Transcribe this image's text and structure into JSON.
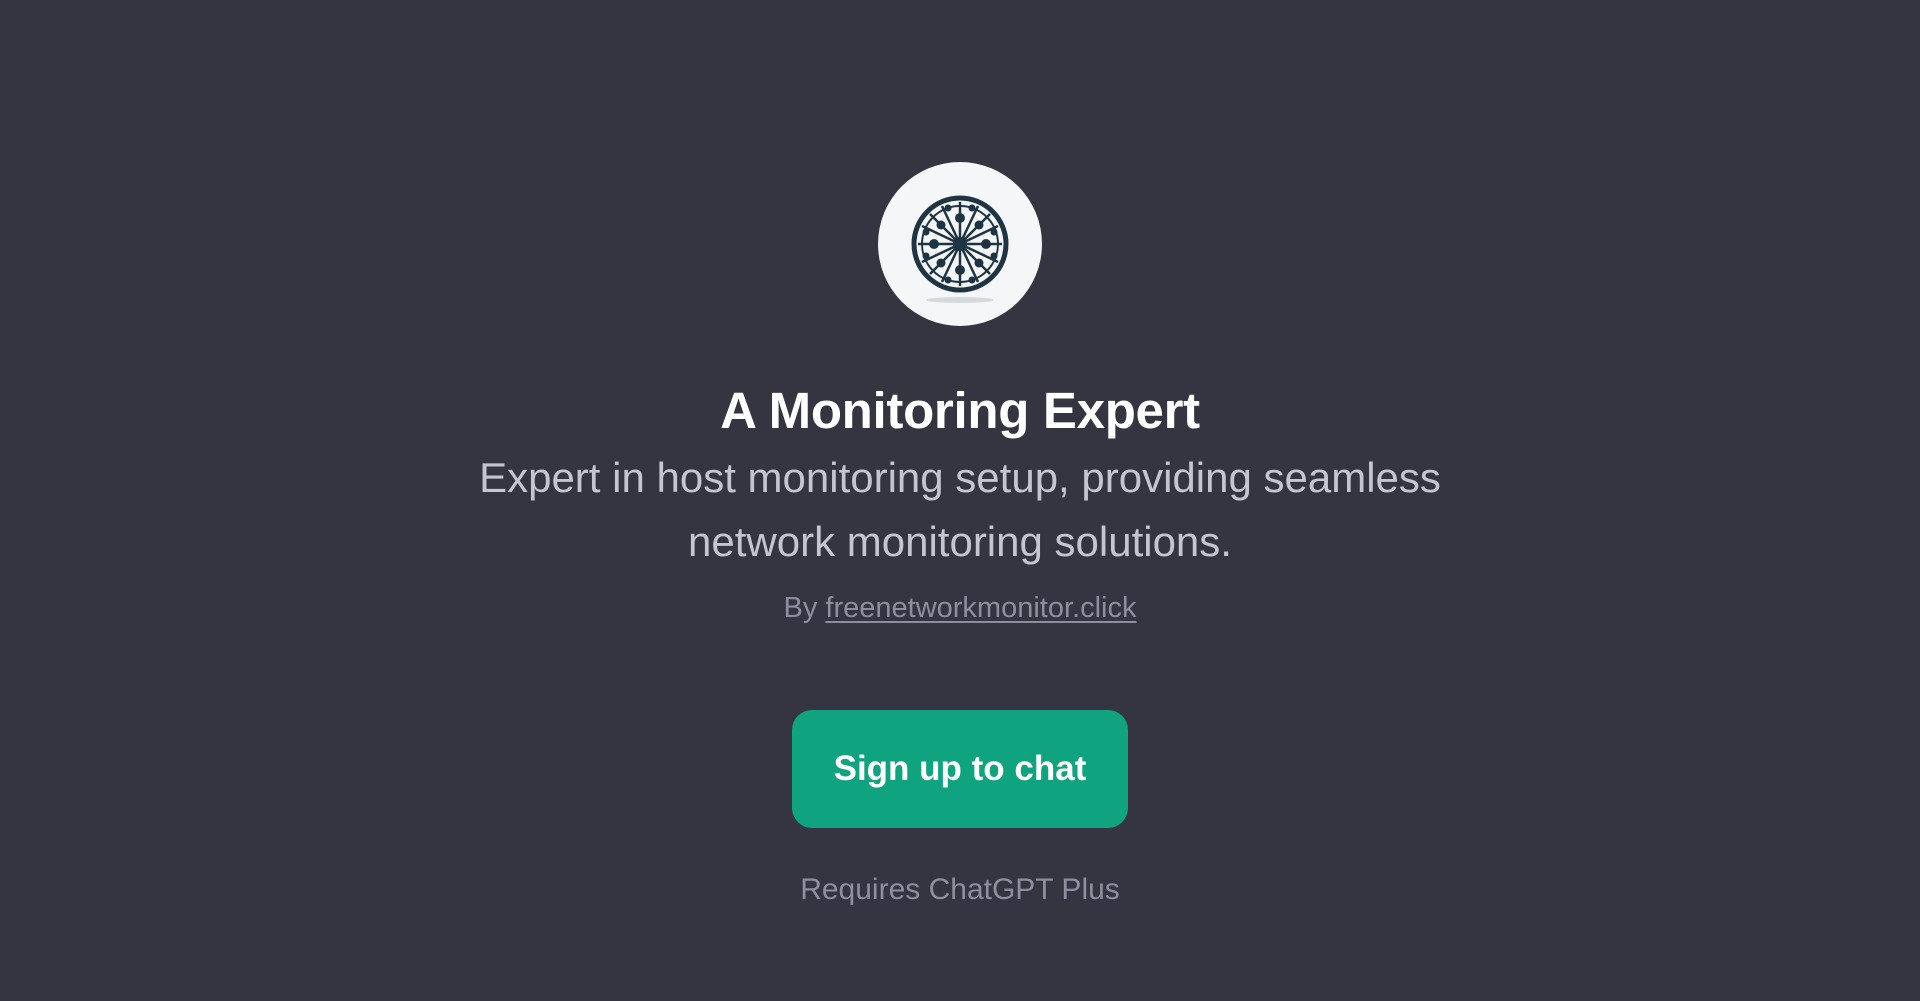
{
  "gpt": {
    "title": "A Monitoring Expert",
    "description": "Expert in host monitoring setup, providing seamless network monitoring solutions.",
    "byline_prefix": "By ",
    "author_link": "freenetworkmonitor.click",
    "avatar_icon": "network-globe-icon"
  },
  "cta": {
    "signup_label": "Sign up to chat",
    "requires_note": "Requires ChatGPT Plus"
  },
  "colors": {
    "background": "#343541",
    "accent": "#10a37f",
    "title": "#ffffff",
    "description": "#c5c5d2",
    "muted": "#8e8ea0"
  }
}
